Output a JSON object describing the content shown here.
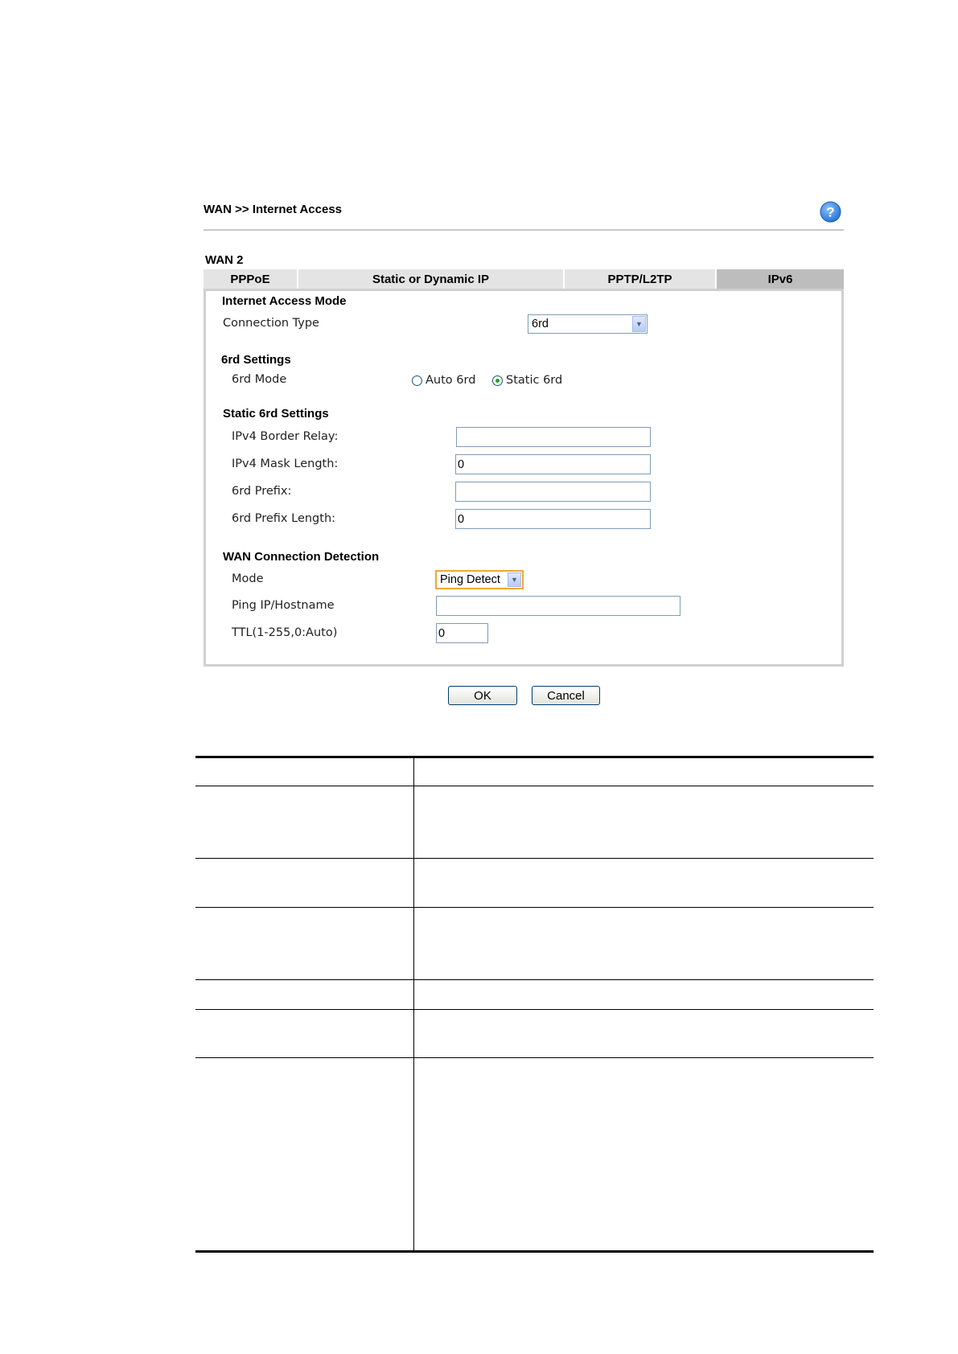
{
  "header": {
    "breadcrumb": "WAN >> Internet Access",
    "help_icon": "help-question-icon"
  },
  "section_label": "WAN 2",
  "tabs": [
    {
      "label": "PPPoE",
      "active": false
    },
    {
      "label": "Static or Dynamic IP",
      "active": false
    },
    {
      "label": "PPTP/L2TP",
      "active": false
    },
    {
      "label": "IPv6",
      "active": true
    }
  ],
  "internet_access_mode": {
    "heading": "Internet Access Mode",
    "connection_type_label": "Connection Type",
    "connection_type_value": "6rd"
  },
  "sixrd_settings": {
    "heading": "6rd Settings",
    "mode_label": "6rd Mode",
    "options": [
      {
        "label": "Auto 6rd",
        "selected": false
      },
      {
        "label": "Static 6rd",
        "selected": true
      }
    ]
  },
  "static_6rd_settings": {
    "heading": "Static 6rd Settings",
    "ipv4_border_relay_label": "IPv4 Border Relay:",
    "ipv4_border_relay_value": "",
    "ipv4_mask_length_label": "IPv4 Mask Length:",
    "ipv4_mask_length_value": "0",
    "prefix_label": "6rd Prefix:",
    "prefix_value": "",
    "prefix_length_label": "6rd Prefix Length:",
    "prefix_length_value": "0"
  },
  "wan_connection_detection": {
    "heading": "WAN Connection Detection",
    "mode_label": "Mode",
    "mode_value": "Ping Detect",
    "ping_label": "Ping IP/Hostname",
    "ping_value": "",
    "ttl_label": "TTL(1-255,0:Auto)",
    "ttl_value": "0"
  },
  "buttons": {
    "ok": "OK",
    "cancel": "Cancel"
  },
  "colors": {
    "help_icon": "#3a8ee6",
    "active_tab": "#bdbdbd",
    "tab": "#e4e4e4",
    "highlight_select": "#f0a830"
  }
}
